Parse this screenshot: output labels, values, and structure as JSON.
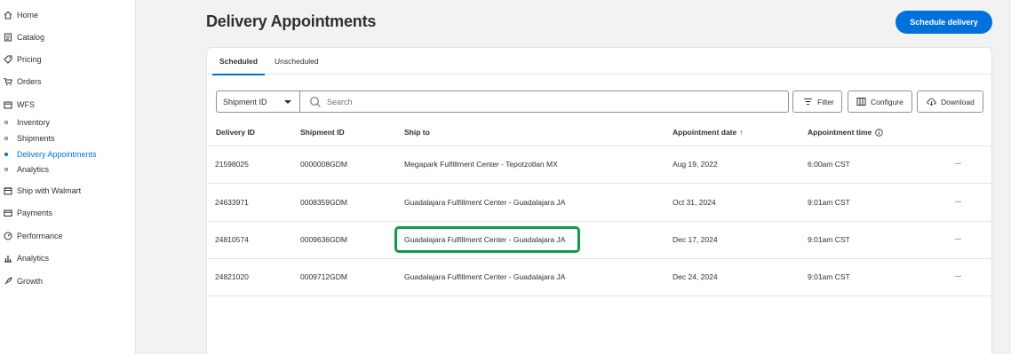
{
  "sidebar": {
    "items": [
      {
        "label": "Home",
        "icon": "home-icon"
      },
      {
        "label": "Catalog",
        "icon": "catalog-icon"
      },
      {
        "label": "Pricing",
        "icon": "tag-icon"
      },
      {
        "label": "Orders",
        "icon": "cart-icon"
      },
      {
        "label": "WFS",
        "icon": "box-icon"
      }
    ],
    "wfs_sub": [
      {
        "label": "Inventory",
        "active": false
      },
      {
        "label": "Shipments",
        "active": false
      },
      {
        "label": "Delivery Appointments",
        "active": true
      },
      {
        "label": "Analytics",
        "active": false
      }
    ],
    "items2": [
      {
        "label": "Ship with Walmart",
        "icon": "calendar-truck-icon"
      },
      {
        "label": "Payments",
        "icon": "card-icon"
      },
      {
        "label": "Performance",
        "icon": "gauge-icon"
      },
      {
        "label": "Analytics",
        "icon": "bar-chart-icon"
      },
      {
        "label": "Growth",
        "icon": "rocket-icon"
      }
    ]
  },
  "header": {
    "title": "Delivery Appointments",
    "primary_action": "Schedule delivery"
  },
  "tabs": [
    {
      "label": "Scheduled",
      "active": true
    },
    {
      "label": "Unscheduled",
      "active": false
    }
  ],
  "toolbar": {
    "select_value": "Shipment ID",
    "search_placeholder": "Search",
    "filter_label": "Filter",
    "configure_label": "Configure",
    "download_label": "Download"
  },
  "table": {
    "columns": [
      "Delivery ID",
      "Shipment ID",
      "Ship to",
      "Appointment date",
      "Appointment time"
    ],
    "sort_indicator": "↑",
    "rows": [
      {
        "delivery_id": "21598025",
        "shipment_id": "0000008GDM",
        "ship_to": "Megapark Fulfillment Center - Tepotzotlan MX",
        "date": "Aug 19, 2022",
        "time": "6:00am CST"
      },
      {
        "delivery_id": "24633971",
        "shipment_id": "0008359GDM",
        "ship_to": "Guadalajara Fulfillment Center - Guadalajara JA",
        "date": "Oct 31, 2024",
        "time": "9:01am CST"
      },
      {
        "delivery_id": "24810574",
        "shipment_id": "0009636GDM",
        "ship_to": "Guadalajara Fulfillment Center - Guadalajara JA",
        "date": "Dec 17, 2024",
        "time": "9:01am CST"
      },
      {
        "delivery_id": "24821020",
        "shipment_id": "0009712GDM",
        "ship_to": "Guadalajara Fulfillment Center - Guadalajara JA",
        "date": "Dec 24, 2024",
        "time": "9:01am CST"
      }
    ],
    "row_action": "···"
  },
  "colors": {
    "accent": "#0071dc",
    "highlight": "#0f9a4a"
  }
}
